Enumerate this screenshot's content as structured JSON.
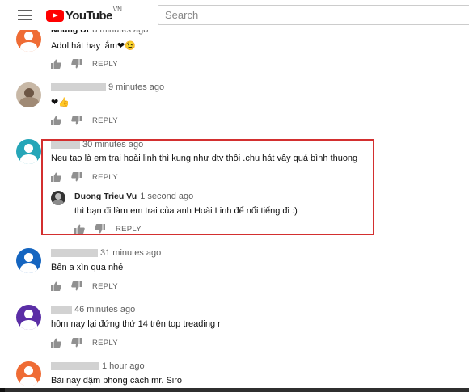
{
  "header": {
    "logo_text": "YouTube",
    "logo_region": "VN",
    "search_placeholder": "Search"
  },
  "comments": [
    {
      "author": "Nhung Ut",
      "time": "8 minutes ago",
      "text": "Adol hát hay lắm❤😉",
      "reply_label": "REPLY",
      "avatar_color": "#ef6c35"
    },
    {
      "time": "9 minutes ago",
      "text": "❤👍",
      "reply_label": "REPLY"
    },
    {
      "time": "30 minutes ago",
      "text": "Neu tao là em trai hoài linh thì kung như dtv thôi .chu hát vây quá bình thuong",
      "reply_label": "REPLY",
      "avatar_color": "#26a6b8",
      "reply": {
        "author": "Duong Trieu Vu",
        "time": "1 second ago",
        "text": "thì bạn đi làm em trai của anh Hoài Linh để nổi tiếng đi :)",
        "reply_label": "REPLY"
      }
    },
    {
      "time": "31 minutes ago",
      "text": "Bên a xìn qua nhé",
      "reply_label": "REPLY",
      "avatar_color": "#1565c0"
    },
    {
      "time": "46 minutes ago",
      "text": "hôm nay lại đứng thứ 14 trên top treading r",
      "reply_label": "REPLY",
      "avatar_color": "#5b2ea6"
    },
    {
      "time": "1 hour ago",
      "text": "Bài này đậm phong cách mr. Siro",
      "avatar_color": "#ef6c35"
    }
  ],
  "colors": {
    "highlight": "#d32f2f",
    "logo_red": "#ff0000"
  }
}
